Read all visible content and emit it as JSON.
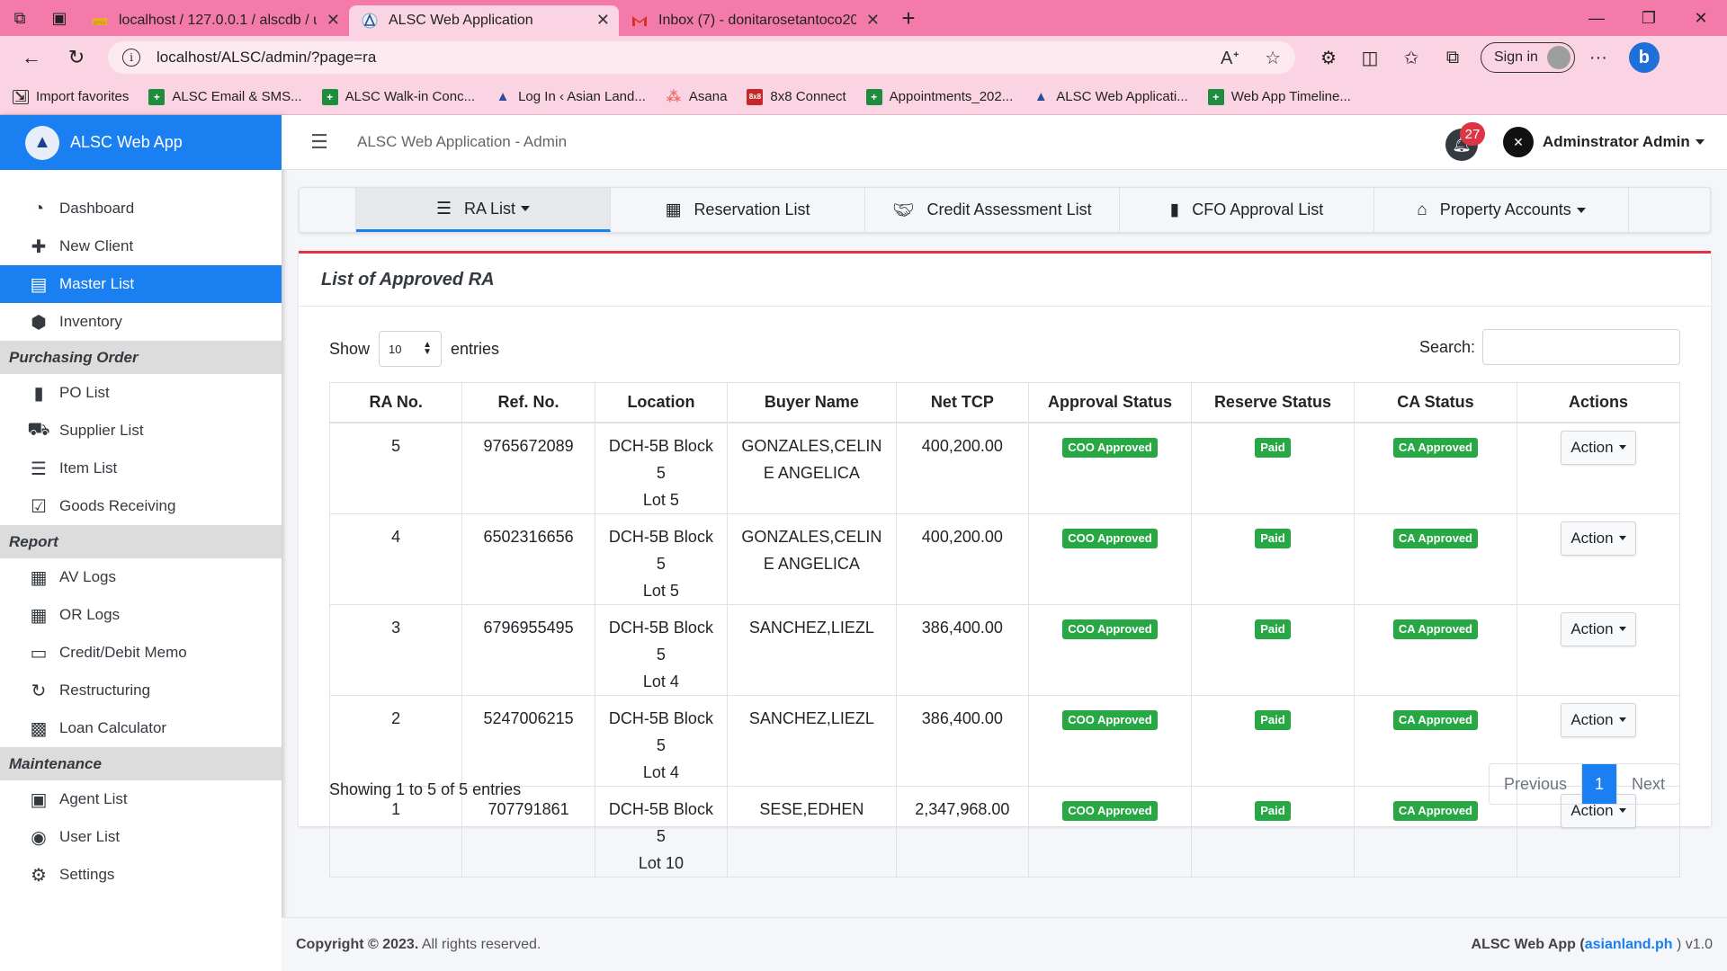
{
  "browser": {
    "tabs": [
      {
        "title": "localhost / 127.0.0.1 / alscdb / us",
        "favicon": "phpmyadmin-icon"
      },
      {
        "title": "ALSC Web Application",
        "favicon": "alsc-logo-icon"
      },
      {
        "title": "Inbox (7) - donitarosetantoco202",
        "favicon": "gmail-icon"
      }
    ],
    "url": "localhost/ALSC/admin/?page=ra",
    "sign_in": "Sign in",
    "favorites": [
      {
        "label": "Import favorites",
        "icon": "import-icon"
      },
      {
        "label": "ALSC Email & SMS...",
        "icon": "sheets-icon"
      },
      {
        "label": "ALSC Walk-in Conc...",
        "icon": "sheets-icon"
      },
      {
        "label": "Log In ‹ Asian Land...",
        "icon": "alsc-logo-icon"
      },
      {
        "label": "Asana",
        "icon": "asana-icon"
      },
      {
        "label": "8x8 Connect",
        "icon": "8x8-icon"
      },
      {
        "label": "Appointments_202...",
        "icon": "sheets-icon"
      },
      {
        "label": "ALSC Web Applicati...",
        "icon": "alsc-logo-icon"
      },
      {
        "label": "Web App Timeline...",
        "icon": "sheets-icon"
      }
    ]
  },
  "app": {
    "brand": "ALSC Web App",
    "header_title": "ALSC Web Application - Admin",
    "notification_count": "27",
    "user_name": "Adminstrator Admin"
  },
  "sidebar": {
    "top_items": [
      {
        "label": "Dashboard",
        "icon": "dashboard-icon"
      },
      {
        "label": "New Client",
        "icon": "plus-icon"
      },
      {
        "label": "Master List",
        "icon": "list-icon",
        "active": true
      },
      {
        "label": "Inventory",
        "icon": "box-icon"
      }
    ],
    "sections": [
      {
        "title": "Purchasing Order",
        "items": [
          {
            "label": "PO List",
            "icon": "file-icon"
          },
          {
            "label": "Supplier List",
            "icon": "truck-icon"
          },
          {
            "label": "Item List",
            "icon": "th-list-icon"
          },
          {
            "label": "Goods Receiving",
            "icon": "check-square-icon"
          }
        ]
      },
      {
        "title": "Report",
        "items": [
          {
            "label": "AV Logs",
            "icon": "receipt-icon"
          },
          {
            "label": "OR Logs",
            "icon": "receipt-icon"
          },
          {
            "label": "Credit/Debit Memo",
            "icon": "credit-card-icon"
          },
          {
            "label": "Restructuring",
            "icon": "redo-icon"
          },
          {
            "label": "Loan Calculator",
            "icon": "calculator-icon"
          }
        ]
      },
      {
        "title": "Maintenance",
        "items": [
          {
            "label": "Agent List",
            "icon": "id-card-icon"
          },
          {
            "label": "User List",
            "icon": "user-circle-icon"
          },
          {
            "label": "Settings",
            "icon": "cogs-icon"
          }
        ]
      }
    ]
  },
  "nav_tabs": [
    {
      "label": "RA List",
      "icon": "list-icon",
      "dropdown": true,
      "active": true
    },
    {
      "label": "Reservation List",
      "icon": "calendar-icon",
      "dropdown": false
    },
    {
      "label": "Credit Assessment List",
      "icon": "handshake-icon",
      "dropdown": false
    },
    {
      "label": "CFO Approval List",
      "icon": "file-icon",
      "dropdown": false
    },
    {
      "label": "Property Accounts",
      "icon": "home-icon",
      "dropdown": true
    }
  ],
  "card": {
    "title": "List of Approved RA",
    "show_label": "Show",
    "entries_value": "10",
    "entries_label": "entries",
    "search_label": "Search:",
    "columns": [
      "RA No.",
      "Ref. No.",
      "Location",
      "Buyer Name",
      "Net TCP",
      "Approval Status",
      "Reserve Status",
      "CA Status",
      "Actions"
    ],
    "rows": [
      {
        "ra": "5",
        "ref": "9765672089",
        "loc1": "DCH-5B Block 5",
        "loc2": "Lot 5",
        "buyer1": "GONZALES,CELIN",
        "buyer2": "E ANGELICA",
        "tcp": "400,200.00",
        "approval": "COO Approved",
        "reserve": "Paid",
        "ca": "CA Approved",
        "action": "Action"
      },
      {
        "ra": "4",
        "ref": "6502316656",
        "loc1": "DCH-5B Block 5",
        "loc2": "Lot 5",
        "buyer1": "GONZALES,CELIN",
        "buyer2": "E ANGELICA",
        "tcp": "400,200.00",
        "approval": "COO Approved",
        "reserve": "Paid",
        "ca": "CA Approved",
        "action": "Action"
      },
      {
        "ra": "3",
        "ref": "6796955495",
        "loc1": "DCH-5B Block 5",
        "loc2": "Lot 4",
        "buyer1": "SANCHEZ,LIEZL",
        "buyer2": "",
        "tcp": "386,400.00",
        "approval": "COO Approved",
        "reserve": "Paid",
        "ca": "CA Approved",
        "action": "Action"
      },
      {
        "ra": "2",
        "ref": "5247006215",
        "loc1": "DCH-5B Block 5",
        "loc2": "Lot 4",
        "buyer1": "SANCHEZ,LIEZL",
        "buyer2": "",
        "tcp": "386,400.00",
        "approval": "COO Approved",
        "reserve": "Paid",
        "ca": "CA Approved",
        "action": "Action"
      },
      {
        "ra": "1",
        "ref": "707791861",
        "loc1": "DCH-5B Block 5",
        "loc2": "Lot 10",
        "buyer1": "SESE,EDHEN",
        "buyer2": "",
        "tcp": "2,347,968.00",
        "approval": "COO Approved",
        "reserve": "Paid",
        "ca": "CA Approved",
        "action": "Action"
      }
    ],
    "info": "Showing 1 to 5 of 5 entries",
    "pager": {
      "prev": "Previous",
      "current": "1",
      "next": "Next"
    }
  },
  "footer": {
    "copyright": "Copyright © 2023.",
    "rights": " All rights reserved.",
    "app_name": "ALSC Web App",
    "link": "asianland.ph",
    "version": ") v1.0"
  },
  "colors": {
    "primary": "#1a7ff0",
    "success": "#28a745",
    "danger": "#dc3545",
    "browser_frame": "#f47ba9"
  }
}
